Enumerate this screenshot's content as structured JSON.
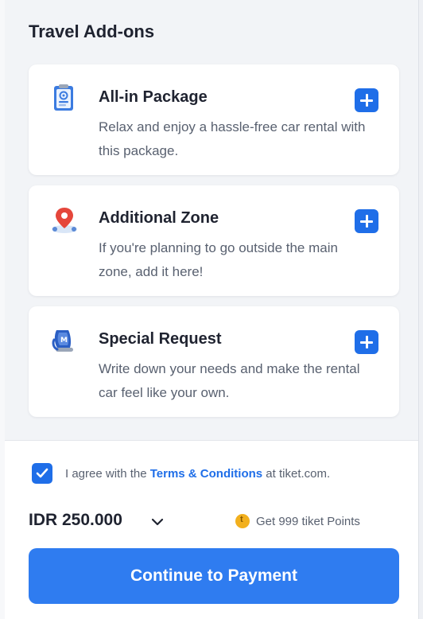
{
  "addons": {
    "title": "Travel Add-ons",
    "items": [
      {
        "title": "All-in Package",
        "description": "Relax and enjoy a hassle-free car rental with this package.",
        "icon": "clipboard-icon"
      },
      {
        "title": "Additional Zone",
        "description": "If you're planning to go outside the main zone, add it here!",
        "icon": "map-pin-icon"
      },
      {
        "title": "Special Request",
        "description": "Write down your needs and make the rental car feel like your own.",
        "icon": "car-seat-icon"
      }
    ]
  },
  "agreement": {
    "checked": true,
    "prefix": "I agree with the ",
    "link": "Terms & Conditions",
    "suffix": " at tiket.com."
  },
  "price": {
    "label": "IDR 250.000",
    "points": "Get 999 tiket Points"
  },
  "cta": {
    "label": "Continue to Payment"
  },
  "colors": {
    "accent": "#1f6ee8",
    "button": "#2f7cf0",
    "coin": "#f2b01e",
    "panel_bg": "#f2f4f7"
  }
}
